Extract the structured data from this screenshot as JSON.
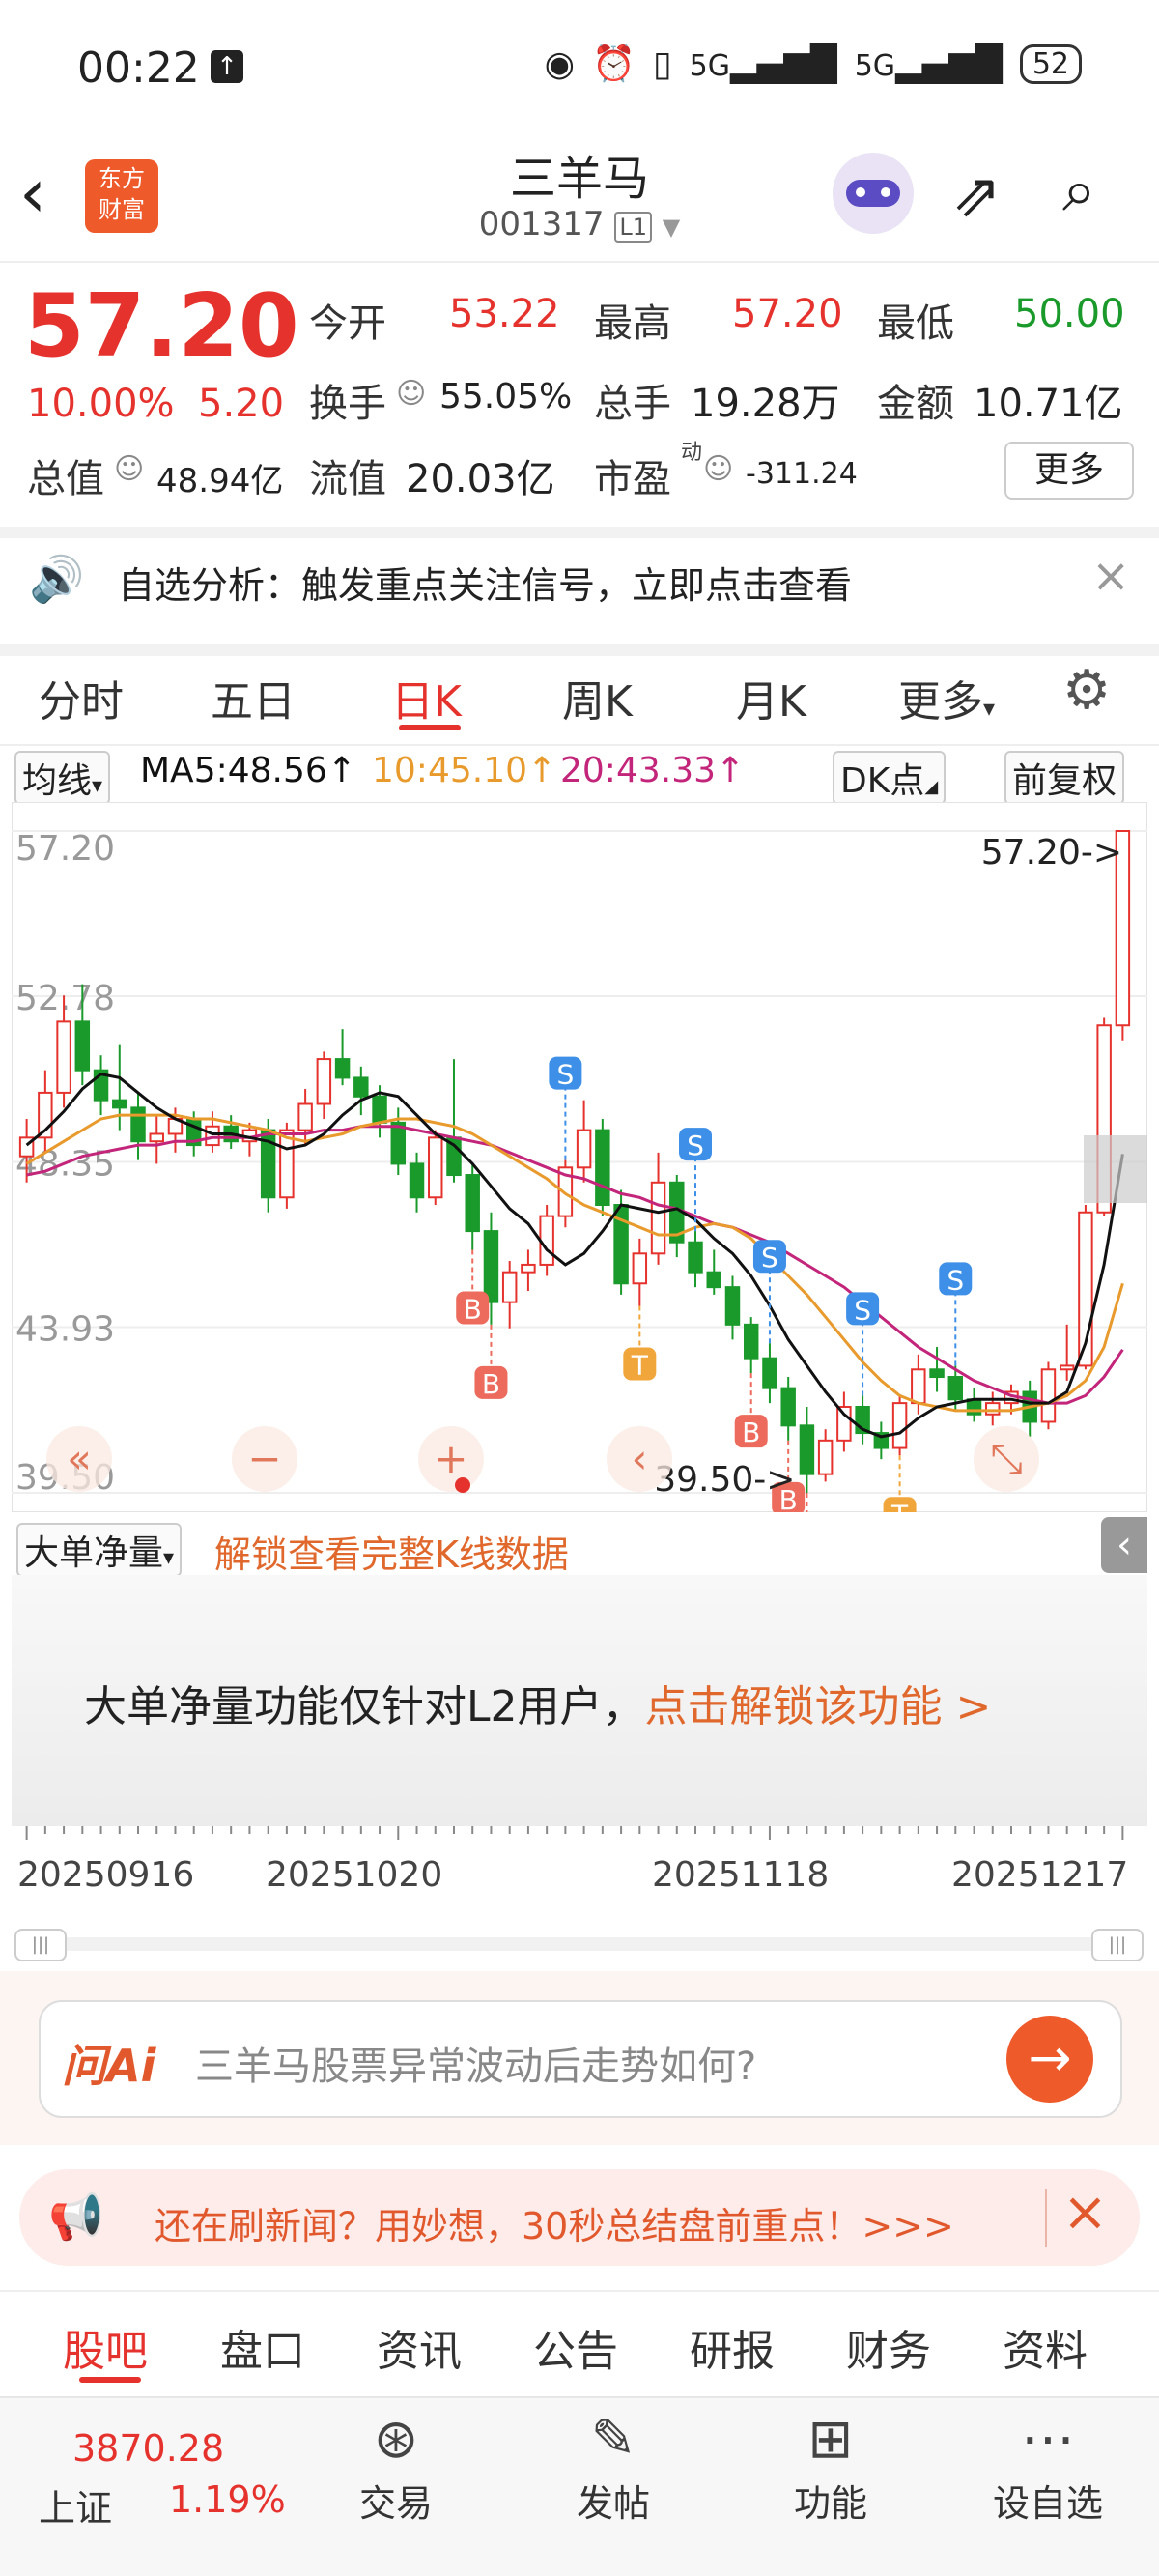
{
  "status": {
    "time": "00:22",
    "battery": "52",
    "net1": "5G",
    "net2": "5G"
  },
  "header": {
    "title": "三羊马",
    "code": "001317",
    "level": "L1",
    "logo_line1": "东方",
    "logo_line2": "财富"
  },
  "quote": {
    "price": "57.20",
    "pct": "10.00%",
    "change": "5.20",
    "open_label": "今开",
    "open": "53.22",
    "high_label": "最高",
    "high": "57.20",
    "low_label": "最低",
    "low": "50.00",
    "turnover_label": "换手",
    "turnover": "55.05%",
    "volume_label": "总手",
    "volume": "19.28万",
    "amount_label": "金额",
    "amount": "10.71亿",
    "mcap_label": "总值",
    "mcap": "48.94亿",
    "float_label": "流值",
    "float": "20.03亿",
    "pe_label": "市盈",
    "pe_sup": "动",
    "pe": "-311.24",
    "more": "更多"
  },
  "notice": {
    "text": "自选分析：触发重点关注信号，立即点击查看"
  },
  "tabs": [
    "分时",
    "五日",
    "日K",
    "周K",
    "月K",
    "更多"
  ],
  "ma": {
    "selector": "均线",
    "ma5": "MA5:48.56↑",
    "ma10": "10:45.10↑",
    "ma20": "20:43.33↑",
    "dk": "DK点",
    "adjust": "前复权",
    "colors": {
      "ma5": "#111111",
      "ma10": "#e89a2c",
      "ma20": "#c2257a"
    }
  },
  "chart_data": {
    "type": "candlestick",
    "y_ticks": [
      "57.20",
      "52.78",
      "48.35",
      "43.93",
      "39.50"
    ],
    "ylim": [
      39.5,
      57.2
    ],
    "x_labels": [
      "20250916",
      "20251020",
      "20251118",
      "20251217"
    ],
    "max_label": "57.20->",
    "min_label": "39.50->",
    "candles": [
      [
        48.5,
        49.5,
        47.8,
        49.0
      ],
      [
        49.0,
        50.8,
        48.6,
        50.2
      ],
      [
        50.2,
        52.8,
        49.8,
        52.1
      ],
      [
        52.1,
        53.1,
        50.4,
        50.8
      ],
      [
        50.8,
        51.2,
        49.6,
        50.0
      ],
      [
        50.0,
        51.5,
        49.2,
        49.8
      ],
      [
        49.8,
        50.2,
        48.4,
        48.9
      ],
      [
        48.9,
        49.6,
        48.3,
        49.1
      ],
      [
        49.1,
        49.8,
        48.6,
        49.5
      ],
      [
        49.5,
        49.7,
        48.5,
        48.8
      ],
      [
        48.8,
        49.7,
        48.6,
        49.3
      ],
      [
        49.3,
        49.6,
        48.7,
        48.9
      ],
      [
        48.9,
        49.4,
        48.5,
        49.2
      ],
      [
        49.2,
        49.5,
        47.0,
        47.4
      ],
      [
        47.4,
        49.4,
        47.1,
        49.2
      ],
      [
        49.2,
        50.3,
        48.8,
        49.9
      ],
      [
        49.9,
        51.3,
        49.5,
        51.1
      ],
      [
        51.1,
        51.9,
        50.4,
        50.6
      ],
      [
        50.6,
        50.9,
        49.6,
        50.1
      ],
      [
        50.1,
        50.4,
        49.0,
        49.4
      ],
      [
        49.4,
        49.8,
        48.0,
        48.3
      ],
      [
        48.3,
        48.6,
        47.0,
        47.4
      ],
      [
        47.4,
        49.2,
        47.2,
        49.0
      ],
      [
        49.0,
        51.1,
        47.8,
        48.0
      ],
      [
        48.0,
        48.3,
        46.0,
        46.5
      ],
      [
        46.5,
        47.0,
        44.0,
        44.6
      ],
      [
        44.6,
        45.7,
        43.9,
        45.4
      ],
      [
        45.4,
        46.0,
        44.9,
        45.6
      ],
      [
        45.6,
        47.2,
        45.3,
        46.9
      ],
      [
        46.9,
        48.4,
        46.6,
        48.2
      ],
      [
        48.2,
        50.0,
        47.8,
        49.2
      ],
      [
        49.2,
        49.5,
        46.9,
        47.2
      ],
      [
        47.2,
        47.6,
        44.8,
        45.1
      ],
      [
        45.1,
        46.3,
        44.5,
        45.9
      ],
      [
        45.9,
        48.6,
        45.6,
        47.8
      ],
      [
        47.8,
        48.0,
        45.8,
        46.2
      ],
      [
        46.2,
        46.5,
        45.0,
        45.4
      ],
      [
        45.4,
        46.0,
        44.8,
        45.0
      ],
      [
        45.0,
        45.3,
        43.6,
        44.0
      ],
      [
        44.0,
        44.2,
        42.7,
        43.1
      ],
      [
        43.1,
        43.5,
        41.9,
        42.3
      ],
      [
        42.3,
        42.6,
        40.9,
        41.3
      ],
      [
        41.3,
        41.8,
        39.5,
        40.0
      ],
      [
        40.0,
        41.2,
        39.8,
        40.9
      ],
      [
        40.9,
        42.2,
        40.6,
        41.8
      ],
      [
        41.8,
        42.1,
        40.8,
        41.1
      ],
      [
        41.1,
        41.4,
        40.4,
        40.7
      ],
      [
        40.7,
        42.1,
        40.5,
        41.9
      ],
      [
        41.9,
        43.2,
        41.6,
        42.8
      ],
      [
        42.8,
        43.4,
        42.2,
        42.6
      ],
      [
        42.6,
        42.9,
        41.7,
        42.0
      ],
      [
        42.0,
        42.3,
        41.4,
        41.6
      ],
      [
        41.6,
        42.2,
        41.3,
        41.9
      ],
      [
        41.9,
        42.4,
        41.6,
        42.2
      ],
      [
        42.2,
        42.5,
        41.0,
        41.4
      ],
      [
        41.4,
        43.0,
        41.2,
        42.8
      ],
      [
        42.8,
        44.0,
        42.5,
        42.9
      ],
      [
        42.9,
        47.2,
        42.8,
        47.0
      ],
      [
        47.0,
        52.2,
        46.9,
        52.0
      ],
      [
        52.0,
        57.2,
        51.6,
        57.2
      ]
    ],
    "ma5": [
      48.8,
      49.2,
      49.7,
      50.3,
      50.7,
      50.6,
      50.2,
      49.8,
      49.5,
      49.3,
      49.1,
      49.1,
      49.0,
      48.9,
      48.7,
      48.8,
      49.1,
      49.6,
      50.0,
      50.2,
      50.1,
      49.6,
      49.1,
      48.8,
      48.3,
      47.7,
      47.1,
      46.7,
      46.0,
      45.6,
      45.9,
      46.5,
      47.2,
      47.1,
      47.0,
      47.1,
      46.8,
      46.3,
      45.9,
      45.3,
      44.5,
      43.6,
      42.9,
      42.2,
      41.6,
      41.2,
      41.0,
      41.1,
      41.5,
      41.8,
      41.9,
      42.0,
      42.0,
      42.0,
      41.9,
      41.9,
      42.2,
      43.5,
      45.6,
      48.56
    ],
    "ma10": [
      48.3,
      48.6,
      48.9,
      49.2,
      49.5,
      49.6,
      49.6,
      49.6,
      49.6,
      49.5,
      49.5,
      49.4,
      49.3,
      49.2,
      49.0,
      48.9,
      49.0,
      49.1,
      49.3,
      49.4,
      49.5,
      49.5,
      49.4,
      49.3,
      49.1,
      48.8,
      48.5,
      48.2,
      47.9,
      47.5,
      47.2,
      47.0,
      46.8,
      46.6,
      46.4,
      46.4,
      46.6,
      46.7,
      46.6,
      46.3,
      45.8,
      45.3,
      44.8,
      44.2,
      43.6,
      43.0,
      42.5,
      42.1,
      41.9,
      41.8,
      41.7,
      41.7,
      41.7,
      41.7,
      41.8,
      41.9,
      42.1,
      42.5,
      43.4,
      45.1
    ],
    "ma20": [
      48.0,
      48.1,
      48.3,
      48.5,
      48.6,
      48.7,
      48.8,
      48.8,
      48.9,
      48.9,
      49.0,
      49.0,
      49.0,
      49.1,
      49.1,
      49.1,
      49.2,
      49.2,
      49.3,
      49.3,
      49.3,
      49.2,
      49.1,
      49.0,
      48.9,
      48.8,
      48.6,
      48.4,
      48.2,
      48.0,
      47.9,
      47.7,
      47.5,
      47.4,
      47.2,
      47.1,
      46.9,
      46.7,
      46.6,
      46.4,
      46.2,
      45.9,
      45.6,
      45.3,
      45.0,
      44.6,
      44.2,
      43.8,
      43.4,
      43.1,
      42.8,
      42.5,
      42.3,
      42.1,
      42.0,
      41.9,
      41.9,
      42.1,
      42.6,
      43.33
    ],
    "signals": [
      {
        "type": "B",
        "i": 24
      },
      {
        "type": "B",
        "i": 25
      },
      {
        "type": "S",
        "i": 29
      },
      {
        "type": "T",
        "i": 33
      },
      {
        "type": "S",
        "i": 36
      },
      {
        "type": "S",
        "i": 40
      },
      {
        "type": "B",
        "i": 39
      },
      {
        "type": "B",
        "i": 41
      },
      {
        "type": "B",
        "i": 42
      },
      {
        "type": "S",
        "i": 45
      },
      {
        "type": "T",
        "i": 47
      },
      {
        "type": "S",
        "i": 50
      }
    ]
  },
  "volume_panel": {
    "selector": "大单净量",
    "unlock_link": "解锁查看完整K线数据",
    "msg": "大单净量功能仅针对L2用户，",
    "msg_link": "点击解锁该功能 >"
  },
  "ai": {
    "brand": "问Ai",
    "placeholder": "三羊马股票异常波动后走势如何?"
  },
  "banner": {
    "text": "还在刷新闻？用妙想，30秒总结盘前重点！>>>"
  },
  "bottom_tabs": [
    "股吧",
    "盘口",
    "资讯",
    "公告",
    "研报",
    "财务",
    "资料"
  ],
  "bottom_bar": {
    "index_value": "3870.28",
    "index_name": "上证",
    "index_pct": "1.19%",
    "items": [
      "交易",
      "发帖",
      "功能",
      "设自选"
    ]
  }
}
